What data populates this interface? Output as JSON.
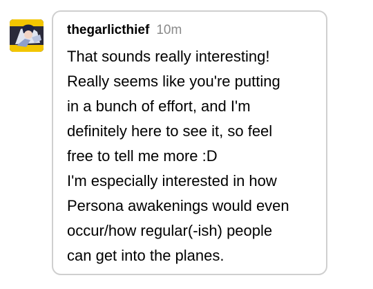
{
  "comment": {
    "username": "thegarlicthief",
    "timestamp": "10m",
    "avatar_icon": "avatar-image",
    "lines": [
      "That sounds really interesting!",
      "Really seems like you're putting",
      "in a bunch of effort, and I'm",
      "definitely here to see it, so feel",
      "free to tell me more :D",
      "I'm especially interested in how",
      "Persona awakenings would even",
      "occur/how regular(-ish) people",
      "can get into the planes."
    ]
  },
  "colors": {
    "border": "#cfcfcf",
    "timestamp": "#8a8a8a",
    "text": "#000000"
  }
}
